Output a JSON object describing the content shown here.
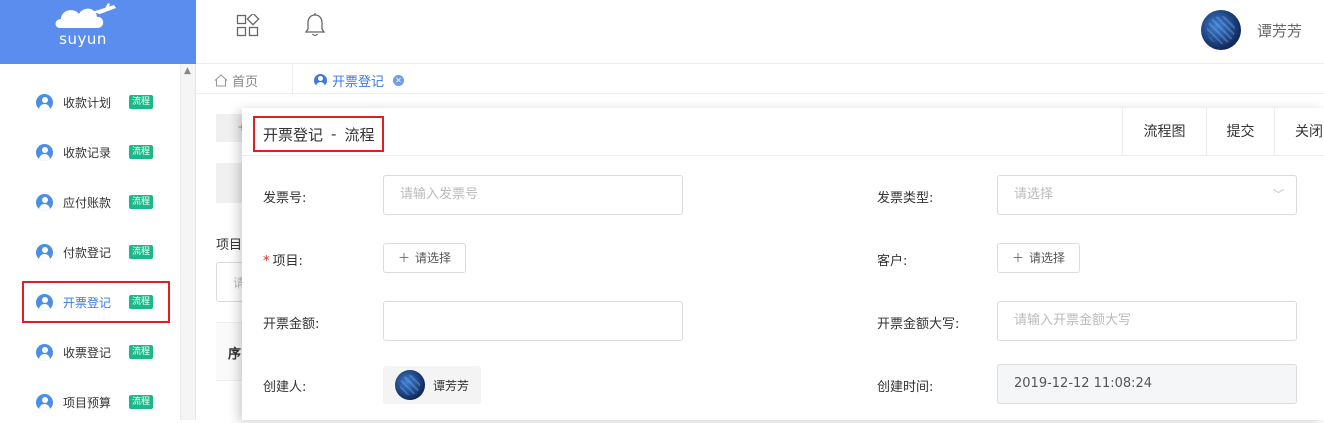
{
  "logo": {
    "brand": "suyun"
  },
  "header": {
    "user_name": "谭芳芳"
  },
  "sidebar": {
    "items": [
      {
        "label": "收款计划",
        "badge": "流程"
      },
      {
        "label": "收款记录",
        "badge": "流程"
      },
      {
        "label": "应付账款",
        "badge": "流程"
      },
      {
        "label": "付款登记",
        "badge": "流程"
      },
      {
        "label": "开票登记",
        "badge": "流程",
        "active": true
      },
      {
        "label": "收票登记",
        "badge": "流程"
      },
      {
        "label": "项目预算",
        "badge": "流程"
      }
    ]
  },
  "tabs": {
    "home": "首页",
    "active": "开票登记"
  },
  "background": {
    "btn_text": "+",
    "label": "项目",
    "input_ph": "请",
    "table_header": "序"
  },
  "modal": {
    "title": "开票登记",
    "title_sep": "-",
    "title_suffix": "流程",
    "buttons": {
      "flow_chart": "流程图",
      "submit": "提交",
      "close": "关闭"
    },
    "fields": {
      "invoice_no": {
        "label": "发票号:",
        "placeholder": "请输入发票号"
      },
      "invoice_type": {
        "label": "发票类型:",
        "placeholder": "请选择"
      },
      "project": {
        "required_mark": "*",
        "label": "项目:",
        "button": "请选择"
      },
      "customer": {
        "label": "客户:",
        "button": "请选择"
      },
      "amount": {
        "label": "开票金额:",
        "value": ""
      },
      "amount_upper": {
        "label": "开票金额大写:",
        "placeholder": "请输入开票金额大写"
      },
      "creator": {
        "label": "创建人:",
        "value": "谭芳芳"
      },
      "created_at": {
        "label": "创建时间:",
        "value": "2019-12-12 11:08:24"
      }
    }
  }
}
